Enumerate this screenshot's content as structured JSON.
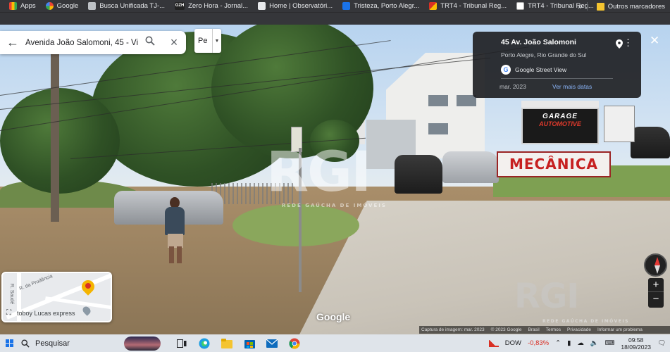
{
  "bookmarks": {
    "items": [
      {
        "label": "Apps",
        "icon": "apps-grid-icon"
      },
      {
        "label": "Google",
        "icon": "google-icon"
      },
      {
        "label": "Busca Unificada TJ-...",
        "icon": "document-icon"
      },
      {
        "label": "Zero Hora - Jornal...",
        "icon": "gzh-icon"
      },
      {
        "label": "Home | Observatóri...",
        "icon": "home-page-icon"
      },
      {
        "label": "Tristeza, Porto Alegr...",
        "icon": "location-icon"
      },
      {
        "label": "TRT4 - Tribunal Reg...",
        "icon": "trt-icon"
      },
      {
        "label": "TRT4 - Tribunal Reg...",
        "icon": "trt-icon"
      }
    ],
    "more": "»",
    "other_folder": "Outros marcadores"
  },
  "search": {
    "value": "Avenida João Salomoni, 45 - Vi",
    "lang": "Pe"
  },
  "info_card": {
    "title": "45 Av. João Salomoni",
    "subtitle": "Porto Alegre, Rio Grande do Sul",
    "source": "Google Street View",
    "date": "mar. 2023",
    "more_dates": "Ver mais datas"
  },
  "scene_signs": {
    "mecanica": "MECÂNICA",
    "garage_line1": "GARAGE",
    "garage_line2": "AUTOMOTIVE"
  },
  "watermark": {
    "main": "RGI",
    "main_sub": "REDE GAÚCHA DE IMÓVEIS",
    "corner": "RGI",
    "corner_sub": "REDE GAÚCHA DE IMÓVEIS"
  },
  "minimap": {
    "street1": "R. da Prudência",
    "street2": "R. Saudé",
    "place": "toboy Lucas express"
  },
  "google_logo": "Google",
  "footer": {
    "capture": "Captura de imagem: mar. 2023",
    "copyright": "© 2023 Google",
    "country": "Brasil",
    "terms": "Termos",
    "privacy": "Privacidade",
    "report": "Informar um problema"
  },
  "taskbar": {
    "search_label": "Pesquisar",
    "stock_name": "DOW",
    "stock_change": "-0,83%",
    "time": "09:58",
    "date": "18/09/2023"
  },
  "colors": {
    "accent_blue": "#8ab4f8",
    "stock_red": "#d93025",
    "card_bg": "#202124"
  }
}
